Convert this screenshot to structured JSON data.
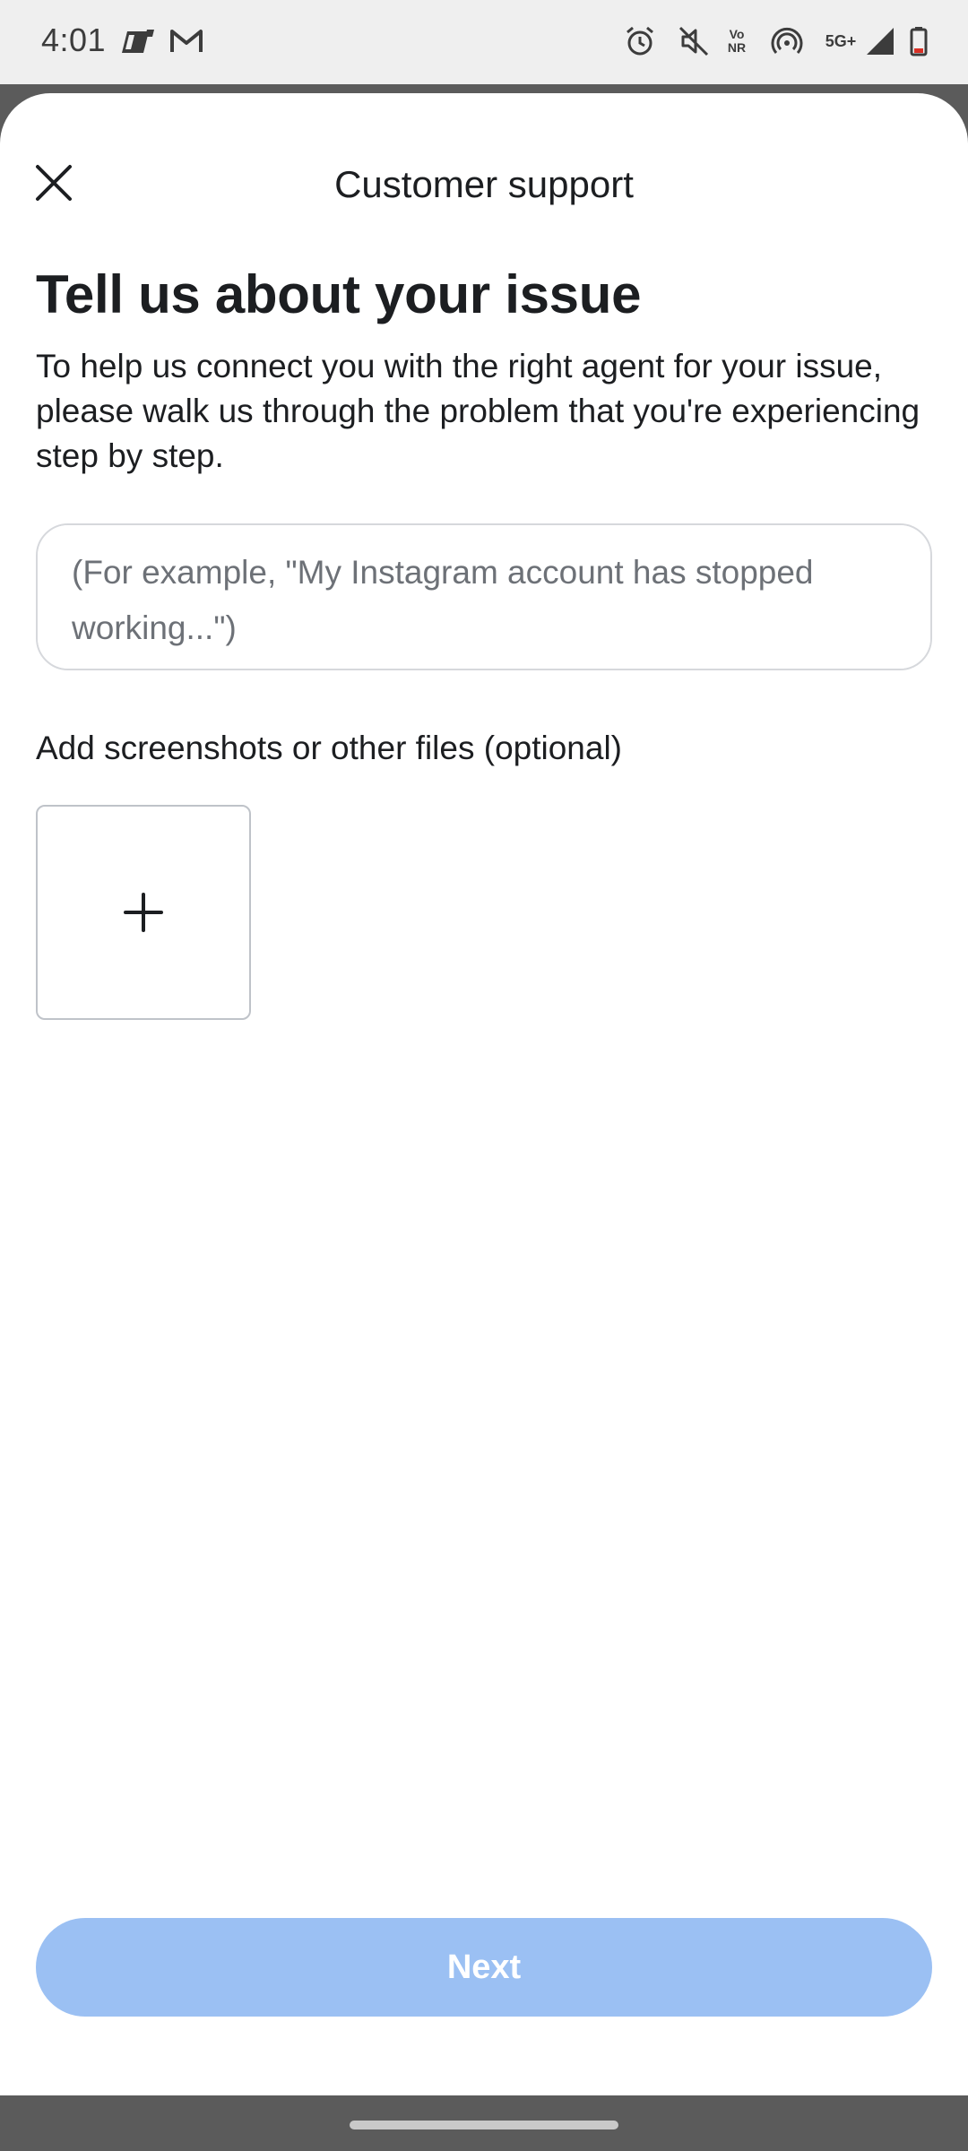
{
  "status_bar": {
    "time": "4:01",
    "left_icons": [
      "mail-app-icon",
      "gmail-icon"
    ],
    "right_icons": [
      "alarm-icon",
      "mute-icon",
      "vonr-icon",
      "hotspot-icon",
      "5g-plus-icon",
      "signal-icon",
      "battery-icon"
    ],
    "network_label": "5G+",
    "vonr_label_top": "Vo",
    "vonr_label_bottom": "NR",
    "battery_color": "#d93025"
  },
  "header": {
    "title": "Customer support",
    "close_icon": "close-icon"
  },
  "main": {
    "heading": "Tell us about your issue",
    "description": "To help us connect you with the right agent for your issue, please walk us through the problem that you're experiencing step by step.",
    "issue_input": {
      "value": "",
      "placeholder": "(For example, \"My Instagram account has stopped working...\")"
    },
    "attachments_label": "Add screenshots or other files (optional)",
    "add_file_icon": "plus-icon"
  },
  "footer": {
    "next_label": "Next",
    "next_color": "#9bc0f3"
  }
}
